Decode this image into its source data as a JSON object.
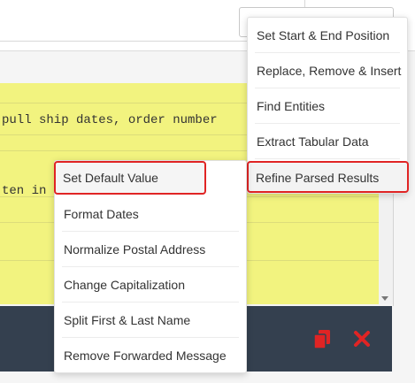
{
  "editor": {
    "line1": "pull ship dates, order number",
    "line2": "ten in"
  },
  "main_menu": {
    "items": [
      {
        "label": "Set Start & End Position"
      },
      {
        "label": "Replace, Remove & Insert"
      },
      {
        "label": "Find Entities"
      },
      {
        "label": "Extract Tabular Data"
      },
      {
        "label": "Refine Parsed Results"
      }
    ]
  },
  "sub_menu": {
    "items": [
      {
        "label": "Set Default Value"
      },
      {
        "label": "Format Dates"
      },
      {
        "label": "Normalize Postal Address"
      },
      {
        "label": "Change Capitalization"
      },
      {
        "label": "Split First & Last Name"
      },
      {
        "label": "Remove Forwarded Message"
      }
    ]
  },
  "toolbar": {
    "icons": [
      "copy-icon",
      "close-icon"
    ]
  },
  "colors": {
    "highlight": "#f2f37f",
    "toolbar_bg": "#34404f",
    "accent_red": "#e02424"
  }
}
